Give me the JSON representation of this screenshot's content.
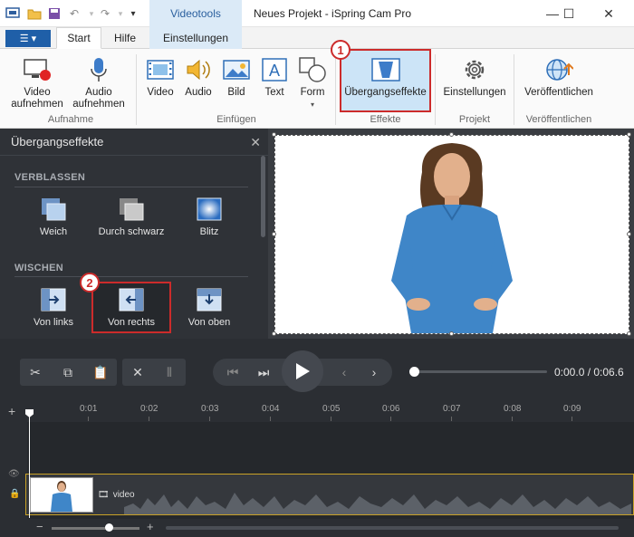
{
  "window": {
    "title": "Neues Projekt - iSpring Cam Pro",
    "context_tab_group": "Videotools",
    "minimize": "—",
    "maximize": "☐",
    "close": "✕"
  },
  "tabs": {
    "file_label": "☰ ▾",
    "items": [
      {
        "label": "Start"
      },
      {
        "label": "Hilfe"
      },
      {
        "label": "Einstellungen"
      }
    ]
  },
  "ribbon": {
    "aufnahme": {
      "video_label": "Video aufnehmen",
      "audio_label": "Audio aufnehmen",
      "group": "Aufnahme"
    },
    "einfuegen": {
      "video": "Video",
      "audio": "Audio",
      "bild": "Bild",
      "text": "Text",
      "form": "Form",
      "group": "Einfügen"
    },
    "effekte": {
      "uebergang": "Übergangseffekte",
      "group": "Effekte"
    },
    "projekt": {
      "einstellungen": "Einstellungen",
      "group": "Projekt"
    },
    "veroeffentlichen": {
      "publish": "Veröffentlichen",
      "group": "Veröffentlichen"
    }
  },
  "badges": {
    "one": "1",
    "two": "2"
  },
  "panel": {
    "title": "Übergangseffekte",
    "close": "✕",
    "sections": [
      {
        "title": "VERBLASSEN",
        "items": [
          {
            "label": "Weich"
          },
          {
            "label": "Durch schwarz"
          },
          {
            "label": "Blitz"
          }
        ]
      },
      {
        "title": "WISCHEN",
        "items": [
          {
            "label": "Von links"
          },
          {
            "label": "Von rechts"
          },
          {
            "label": "Von oben"
          }
        ]
      }
    ]
  },
  "player": {
    "time": "0:00.0 / 0:06.6",
    "progress": 0
  },
  "timeline": {
    "ticks": [
      "0:01",
      "0:02",
      "0:03",
      "0:04",
      "0:05",
      "0:06",
      "0:07",
      "0:08",
      "0:09"
    ],
    "clip_label": "video"
  },
  "colors": {
    "accent": "#1f5fa8",
    "highlight": "#cc2b2b",
    "clip_border": "#c9a227"
  }
}
